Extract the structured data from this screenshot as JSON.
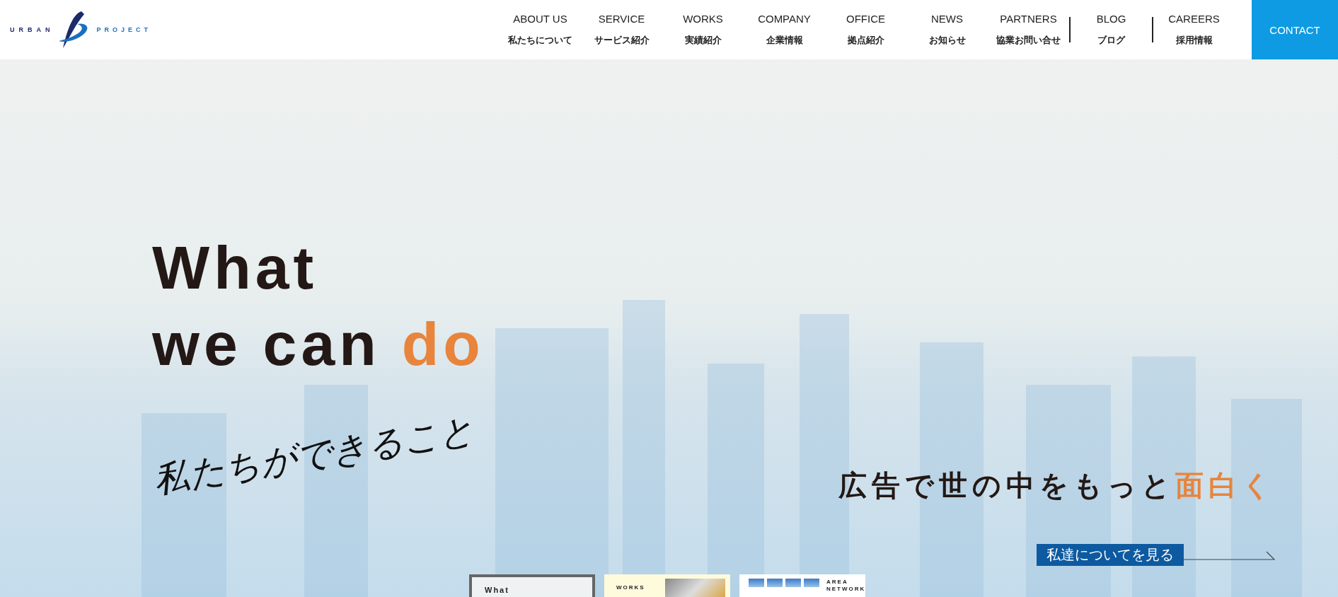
{
  "logo": {
    "left": "URBAN",
    "right": "PROJECT"
  },
  "nav": [
    {
      "en": "ABOUT US",
      "ja": "私たちについて",
      "divider_before": false
    },
    {
      "en": "SERVICE",
      "ja": "サービス紹介",
      "divider_before": false
    },
    {
      "en": "WORKS",
      "ja": "実績紹介",
      "divider_before": false
    },
    {
      "en": "COMPANY",
      "ja": "企業情報",
      "divider_before": false
    },
    {
      "en": "OFFICE",
      "ja": "拠点紹介",
      "divider_before": false
    },
    {
      "en": "NEWS",
      "ja": "お知らせ",
      "divider_before": false
    },
    {
      "en": "PARTNERS",
      "ja": "協業お問い合せ",
      "divider_before": false
    },
    {
      "en": "BLOG",
      "ja": "ブログ",
      "divider_before": true
    },
    {
      "en": "CAREERS",
      "ja": "採用情報",
      "divider_before": true
    }
  ],
  "contact": "CONTACT",
  "hero": {
    "title_lines": [
      "What",
      "we can **do**"
    ],
    "handwriting": "私たちができること",
    "tagline": "広告で世の中をもっと**面白く**",
    "link": "私達についてを見る"
  },
  "cards": [
    {
      "kind": "framed",
      "title": "What"
    },
    {
      "kind": "works",
      "title": "WORKS"
    },
    {
      "kind": "network",
      "title": "AREA NETWORK"
    }
  ]
}
